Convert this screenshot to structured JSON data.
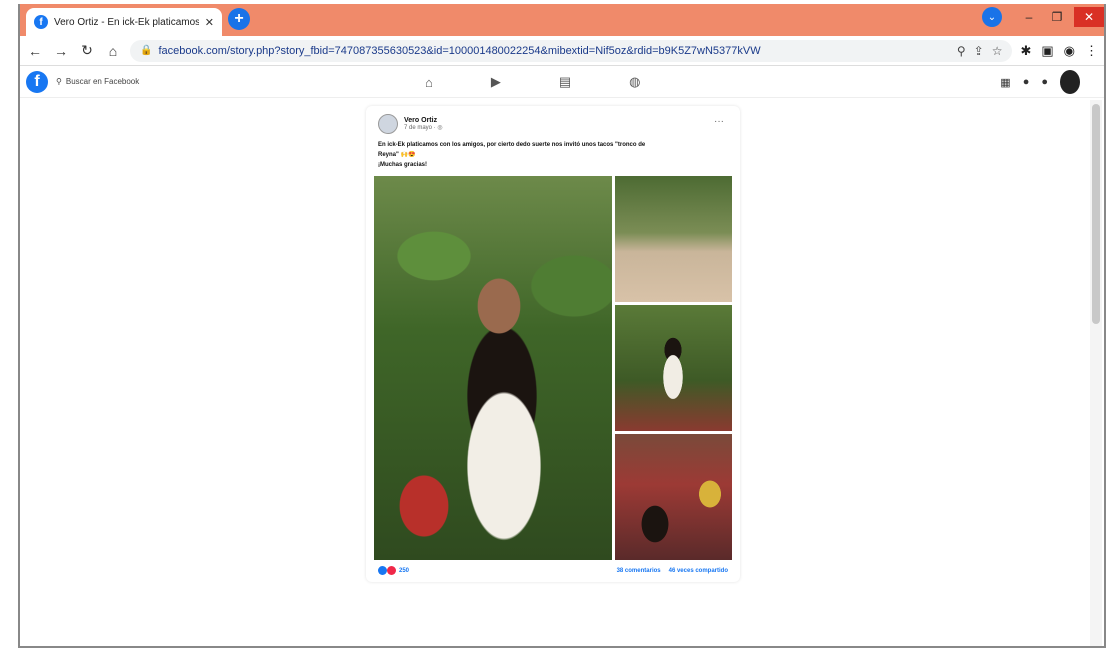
{
  "browser": {
    "tab_title": "Vero Ortiz - En ick-Ek platicamos",
    "tab_close": "✕",
    "new_tab": "+",
    "url": "facebook.com/story.php?story_fbid=747087355630523&id=100001480022254&mibextid=Nif5oz&rdid=b9K5Z7wN5377kVW",
    "window_controls": [
      "–",
      "❐",
      "✕"
    ]
  },
  "facebook": {
    "logo": "f",
    "search_placeholder": "Buscar en Facebook"
  },
  "post": {
    "author": "Vero Ortiz",
    "time": "7 de mayo · ◎",
    "more": "···",
    "text_line1": "En ick-Ek platicamos con los amigos, por cierto dedo suerte nos invitó unos tacos \"tronco de",
    "text_line2": "Reyna\" 🙌😍",
    "text_line3": "¡Muchas gracias!",
    "reaction_count": "250",
    "comments": "38 comentarios",
    "shares": "46 veces compartido"
  }
}
